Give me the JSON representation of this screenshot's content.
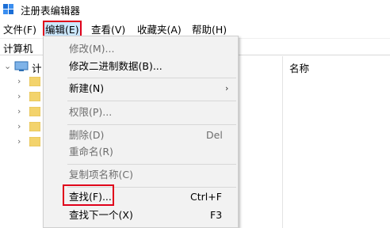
{
  "window": {
    "title": "注册表编辑器"
  },
  "menubar": {
    "items": [
      {
        "label": "文件(F)"
      },
      {
        "label": "编辑(E)"
      },
      {
        "label": "查看(V)"
      },
      {
        "label": "收藏夹(A)"
      },
      {
        "label": "帮助(H)"
      }
    ]
  },
  "address": {
    "path": "计算机"
  },
  "tree": {
    "root_label": "计",
    "child_count": 5
  },
  "right_pane": {
    "column_header": "名称"
  },
  "edit_menu": {
    "items": [
      {
        "label": "修改(M)...",
        "shortcut": "",
        "enabled": false
      },
      {
        "label": "修改二进制数据(B)...",
        "shortcut": "",
        "enabled": true
      },
      {
        "label": "新建(N)",
        "shortcut": "",
        "enabled": true,
        "submenu": true
      },
      {
        "label": "权限(P)...",
        "shortcut": "",
        "enabled": false
      },
      {
        "label": "删除(D)",
        "shortcut": "Del",
        "enabled": false
      },
      {
        "label": "重命名(R)",
        "shortcut": "",
        "enabled": false
      },
      {
        "label": "复制项名称(C)",
        "shortcut": "",
        "enabled": false
      },
      {
        "label": "查找(F)...",
        "shortcut": "Ctrl+F",
        "enabled": true
      },
      {
        "label": "查找下一个(X)",
        "shortcut": "F3",
        "enabled": true
      }
    ],
    "submenu_arrow": "›"
  },
  "colors": {
    "highlight_red": "#e0001a",
    "menu_active_bg": "#cce8ff",
    "menu_bg": "#f2f2f2",
    "disabled_text": "#6d6d6d",
    "folder_yellow": "#f3d36c"
  }
}
